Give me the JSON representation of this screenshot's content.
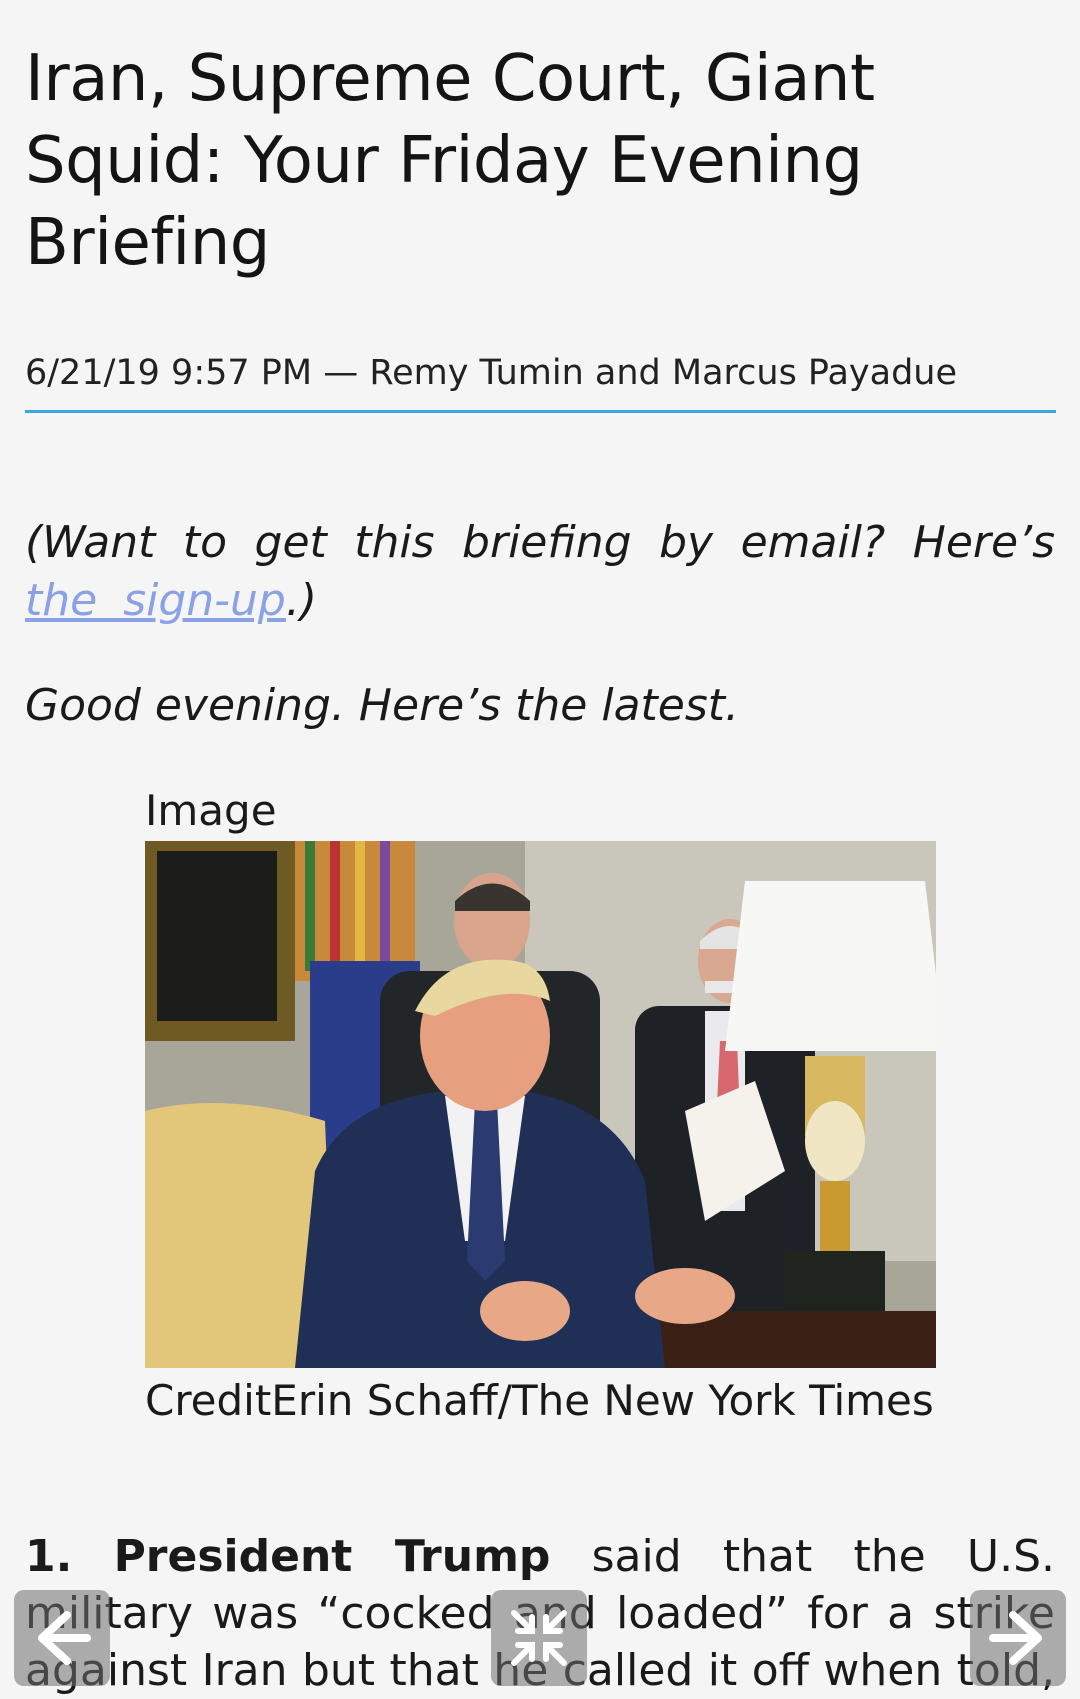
{
  "article": {
    "title": "Iran, Supreme Court, Giant Squid: Your Friday Evening Briefing",
    "byline": "6/21/19 9:57 PM — Remy Tumin and Marcus Payadue",
    "signup_prefix": "(Want to get this briefing by email? Here’s ",
    "signup_link": "the sign-up",
    "signup_suffix": ".)",
    "greeting": "Good evening. Here’s the latest.",
    "image_label": "Image",
    "image_credit": "CreditErin Schaff/The New York Times",
    "story_number": "1.",
    "story_lead": "President Trump",
    "story_text": " said that the U.S. military was “cocked and loaded” for a strike against Iran but that he called it off when told, with just minutes"
  },
  "controls": {
    "prev_icon": "arrow-left-icon",
    "center_icon": "collapse-icon",
    "next_icon": "arrow-right-icon"
  },
  "colors": {
    "background": "#f5f5f5",
    "rule": "#3aa7dc",
    "link": "#8aa1e6",
    "control_bg": "rgba(110,110,110,0.55)"
  }
}
